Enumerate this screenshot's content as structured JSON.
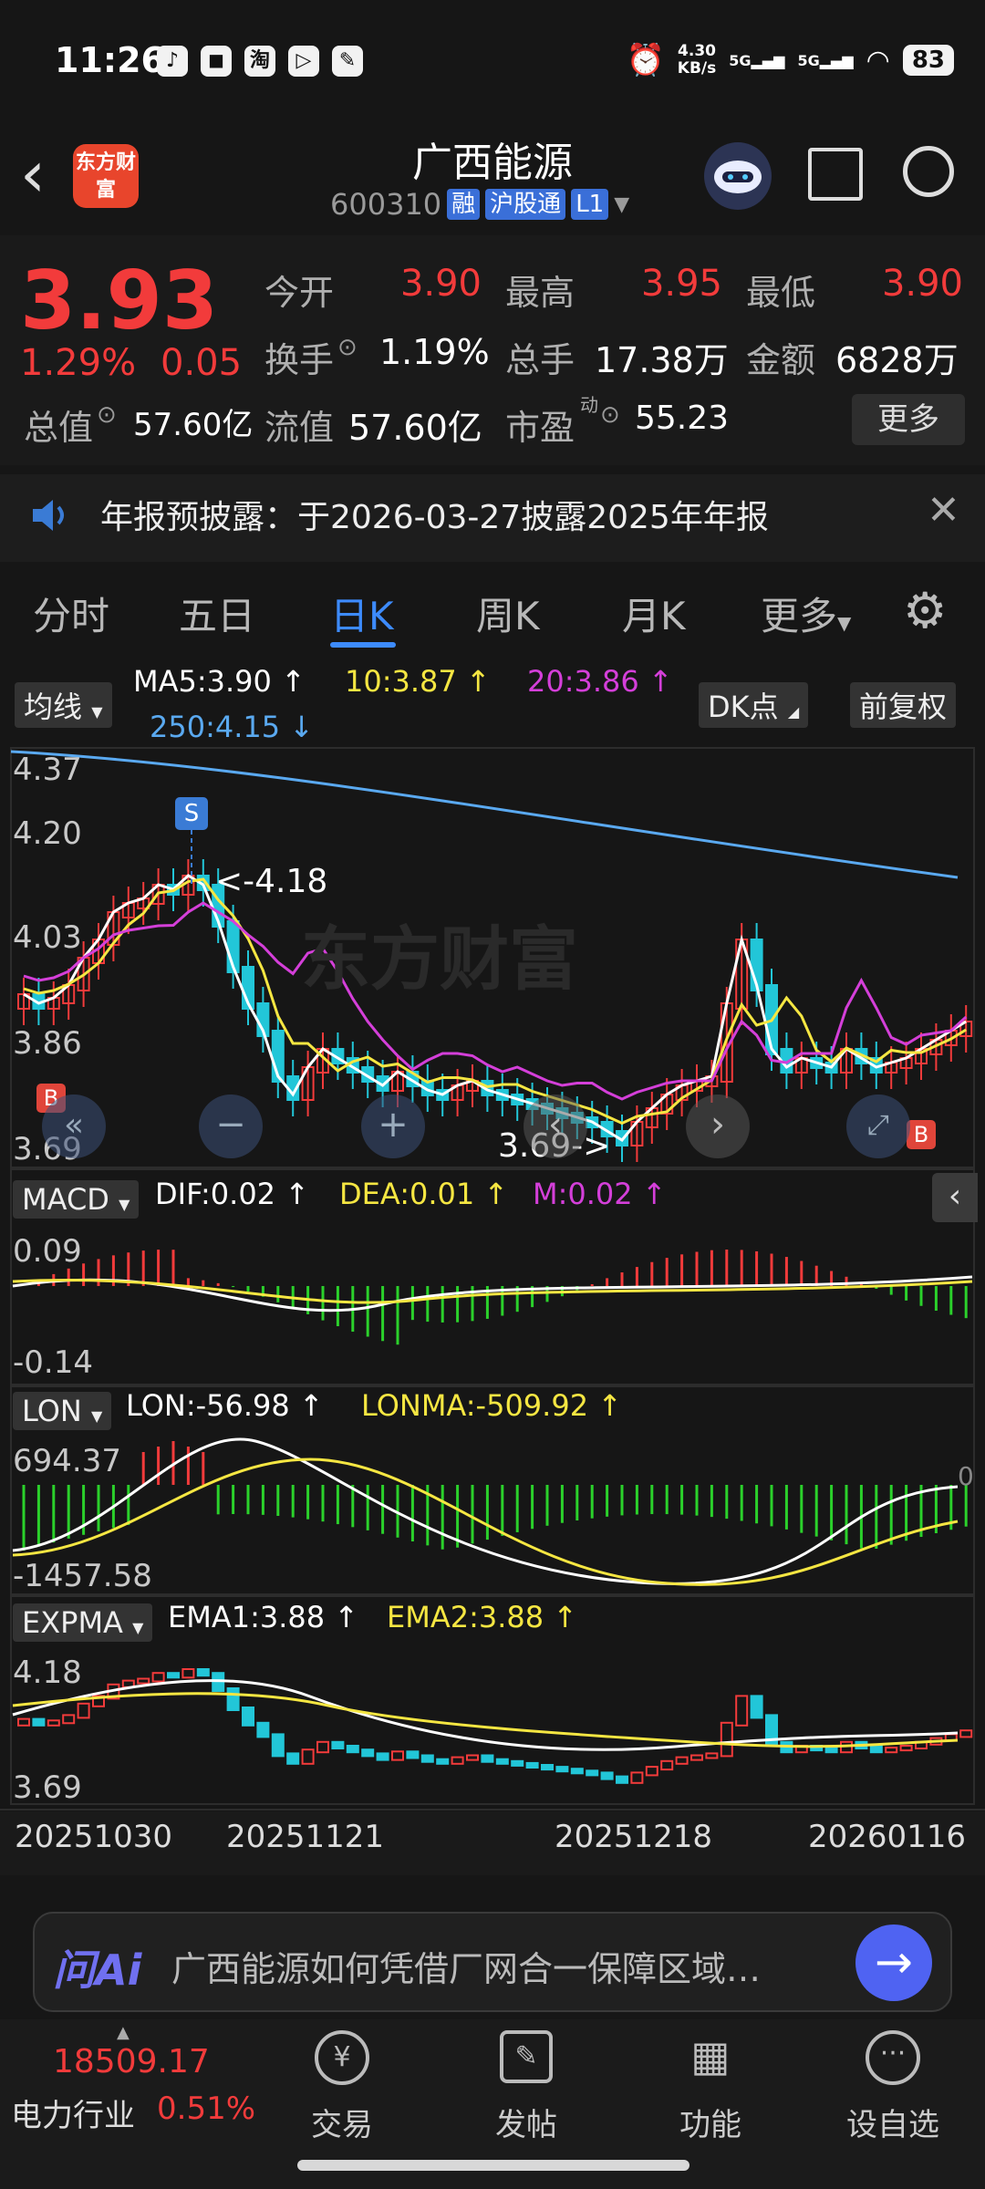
{
  "status": {
    "time": "11:26",
    "net_speed": "4.30",
    "net_unit": "KB/s",
    "sig1": "5G",
    "sig2": "5G",
    "battery": "83"
  },
  "header": {
    "logo": "东方财富",
    "title": "广西能源",
    "code": "600310",
    "tags": [
      "融",
      "沪股通",
      "L1"
    ]
  },
  "quote": {
    "price": "3.93",
    "pct": "1.29%",
    "change": "0.05",
    "row1": [
      {
        "label": "今开",
        "value": "3.90"
      },
      {
        "label": "最高",
        "value": "3.95"
      },
      {
        "label": "最低",
        "value": "3.90"
      }
    ],
    "row2": [
      {
        "label": "换手",
        "value": "1.19%"
      },
      {
        "label": "总手",
        "value": "17.38万"
      },
      {
        "label": "金额",
        "value": "6828万"
      }
    ],
    "row3": [
      {
        "label": "总值",
        "value": "57.60亿"
      },
      {
        "label": "流值",
        "value": "57.60亿"
      },
      {
        "label": "市盈",
        "sup": "动",
        "value": "55.23"
      }
    ],
    "more": "更多"
  },
  "notice": {
    "text": "年报预披露：于2026-03-27披露2025年年报"
  },
  "tabs": [
    "分时",
    "五日",
    "日K",
    "周K",
    "月K",
    "更多"
  ],
  "active_tab": "日K",
  "kline": {
    "chip": "均线",
    "ma5": "MA5:3.90 ↑",
    "ma10": "10:3.87 ↑",
    "ma20": "20:3.86 ↑",
    "ma250": "250:4.15 ↓",
    "dk": "DK点",
    "fq": "前复权",
    "y_labels": [
      "4.37",
      "4.20",
      "4.03",
      "3.86",
      "3.69"
    ],
    "high_mark": "<-4.18",
    "low_mark": "3.69->",
    "watermark": "东方财富",
    "colors": {
      "ma5": "#ffffff",
      "ma10": "#f5e642",
      "ma20": "#d43fd9",
      "ma250": "#5aa9f0",
      "up": "#f23b3b",
      "down": "#22c6d8"
    }
  },
  "macd": {
    "chip": "MACD",
    "dif": "DIF:0.02 ↑",
    "dea": "DEA:0.01 ↑",
    "m": "M:0.02 ↑",
    "y_top": "0.09",
    "y_bot": "-0.14"
  },
  "lon": {
    "chip": "LON",
    "lon": "LON:-56.98 ↑",
    "lonma": "LONMA:-509.92 ↑",
    "y_top": "694.37",
    "y_bot": "-1457.58",
    "zero": "0"
  },
  "expma": {
    "chip": "EXPMA",
    "ema1": "EMA1:3.88 ↑",
    "ema2": "EMA2:3.88 ↑",
    "y_top": "4.18",
    "y_bot": "3.69"
  },
  "dates": [
    "20251030",
    "20251121",
    "20251218",
    "20260116"
  ],
  "ai": {
    "logo": "问Ai",
    "text": "广西能源如何凭借厂网合一保障区域…"
  },
  "nav": {
    "index": "18509.17",
    "industry": "电力行业",
    "industry_pct": "0.51%",
    "items": [
      "交易",
      "发帖",
      "功能",
      "设自选"
    ]
  }
}
